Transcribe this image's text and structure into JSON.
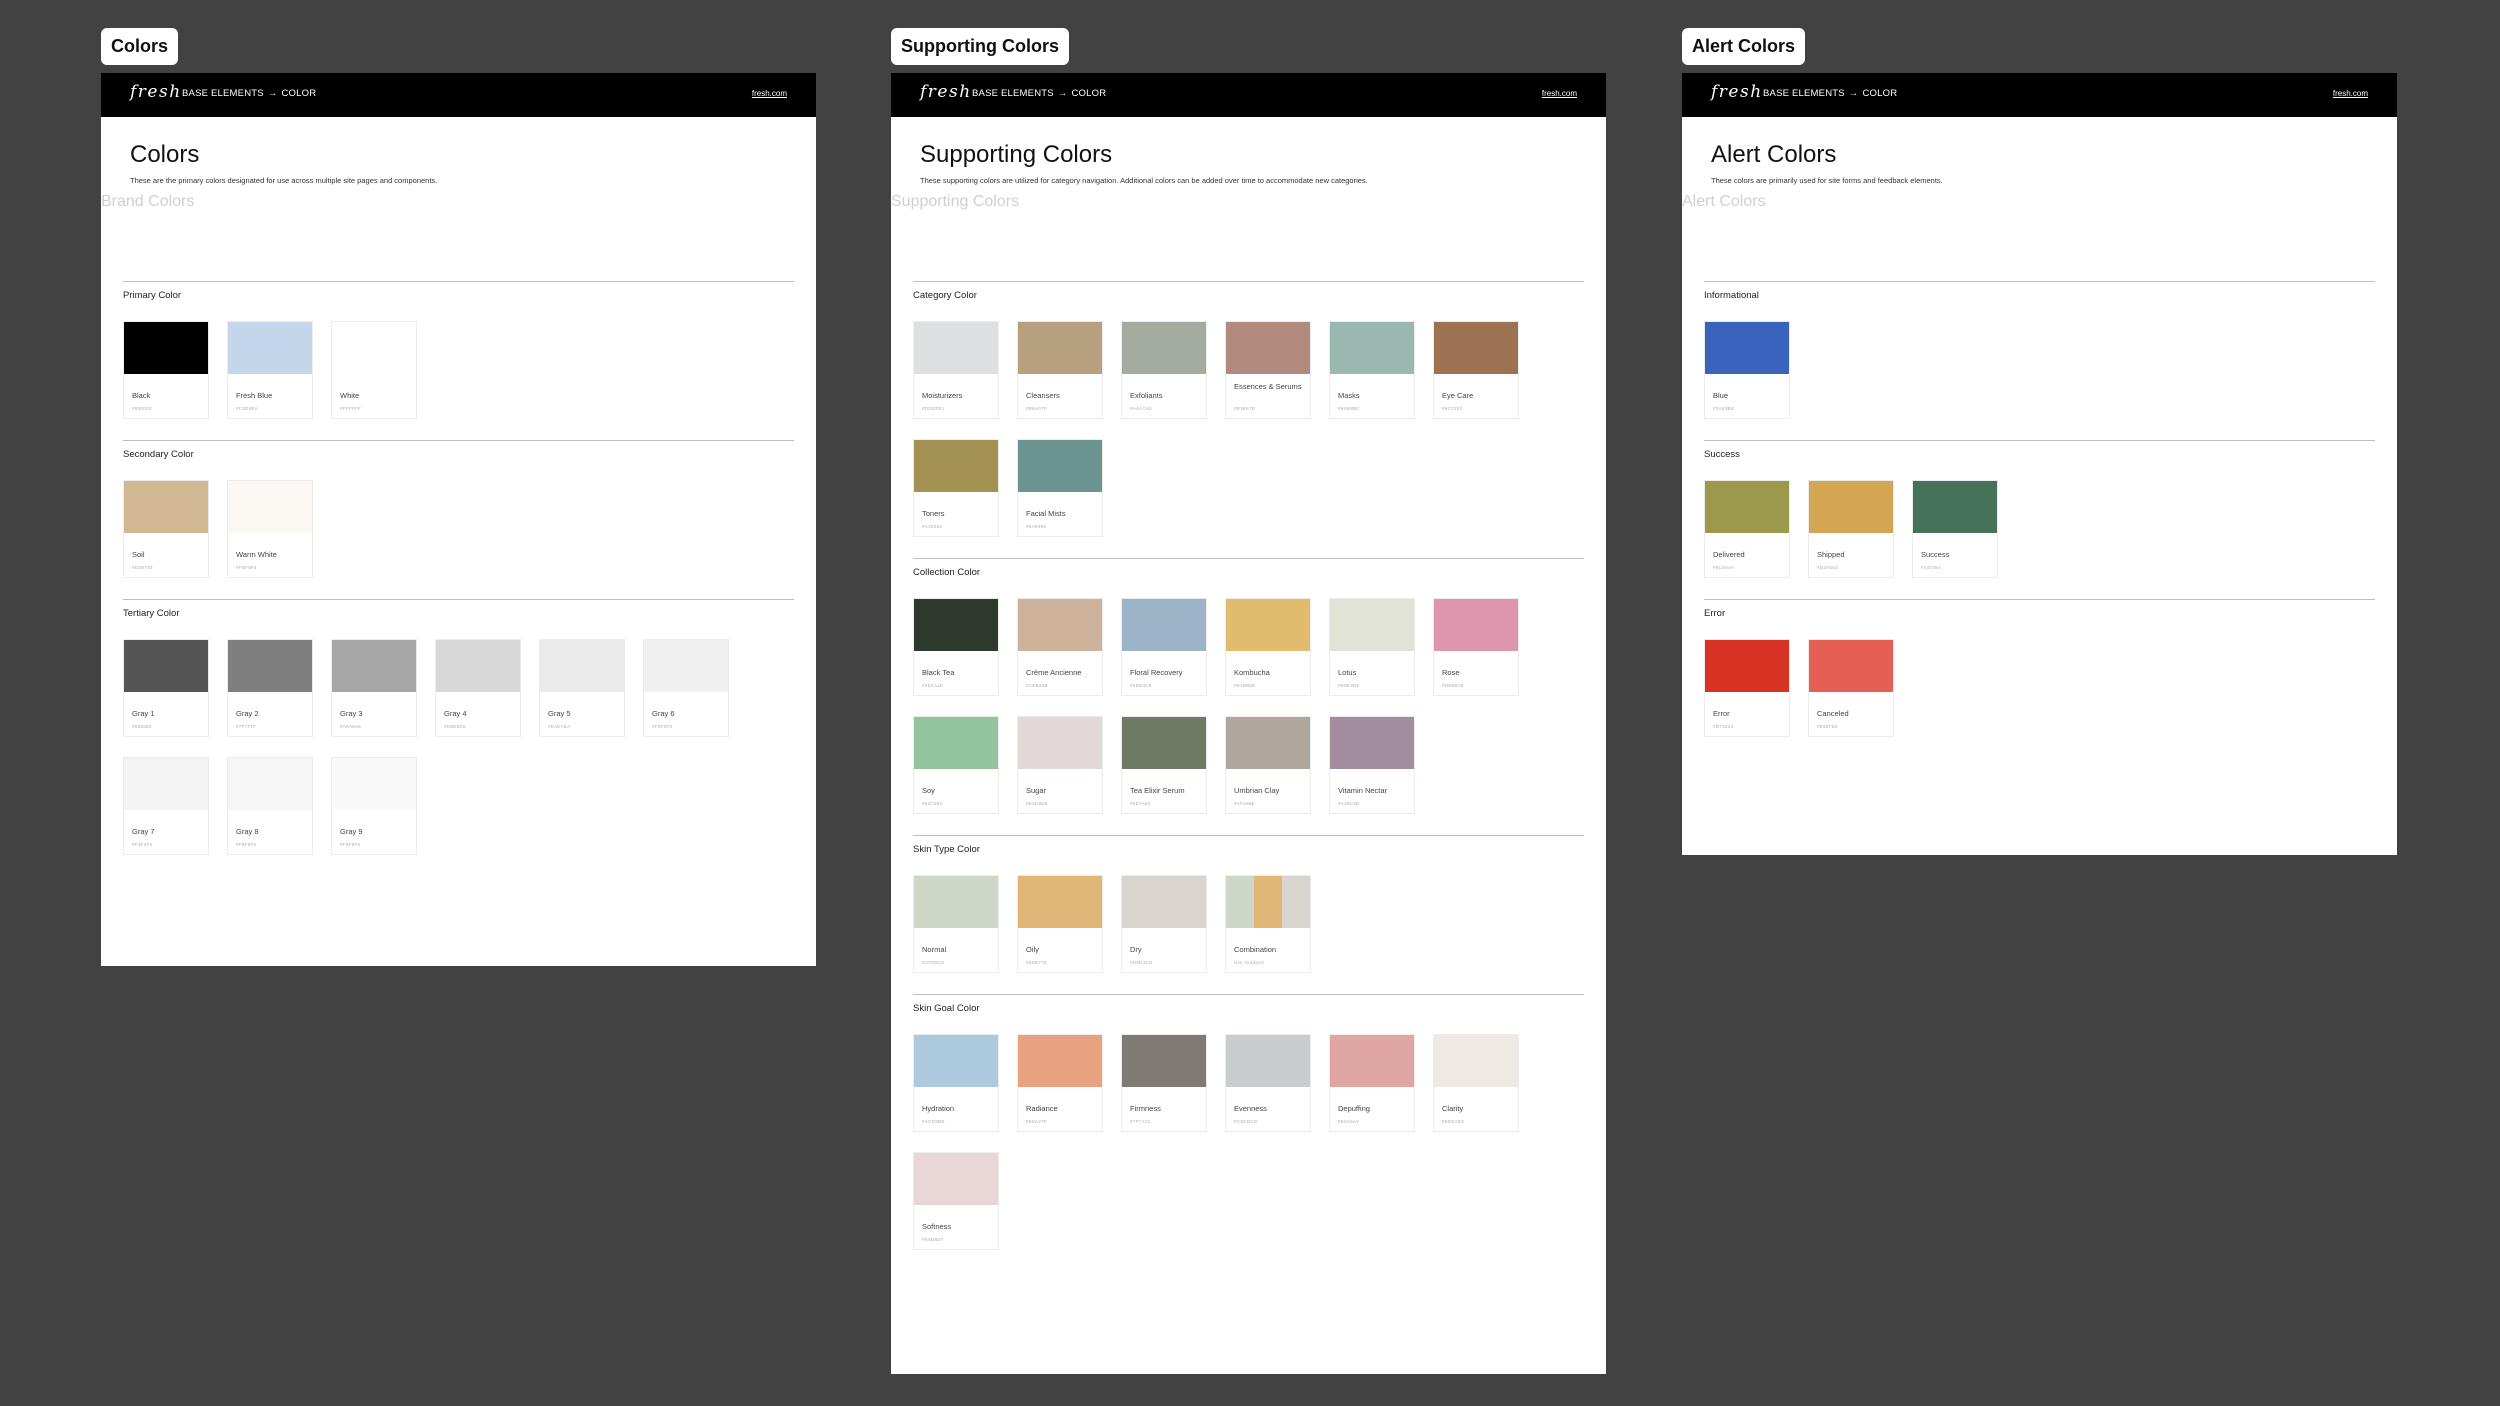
{
  "frames": [
    {
      "label": "Colors",
      "logo": "fresh",
      "crumb_base": "BASE ELEMENTS",
      "crumb_arrow": "→",
      "crumb_current": "COLOR",
      "site_link": "fresh.com",
      "title": "Colors",
      "description": "These are the primary colors designated for use across multiple site pages and components.",
      "ghost_label": "Brand Colors",
      "sections": [
        {
          "title": "Primary Color",
          "swatches": [
            {
              "name": "Black",
              "hex": "#000000",
              "colors": [
                "#000000"
              ]
            },
            {
              "name": "Fresh Blue",
              "hex": "#C3D6EA",
              "colors": [
                "#C3D6EA"
              ]
            },
            {
              "name": "White",
              "hex": "#FFFFFF",
              "colors": [
                "#FFFFFF"
              ]
            }
          ]
        },
        {
          "title": "Secondary Color",
          "swatches": [
            {
              "name": "Soil",
              "hex": "#D2B793",
              "colors": [
                "#D2B793"
              ]
            },
            {
              "name": "Warm White",
              "hex": "#FBF8F4",
              "colors": [
                "#FBF8F4"
              ]
            }
          ]
        },
        {
          "title": "Tertiary Color",
          "swatches": [
            {
              "name": "Gray 1",
              "hex": "#555555",
              "colors": [
                "#555555"
              ]
            },
            {
              "name": "Gray 2",
              "hex": "#7F7F7F",
              "colors": [
                "#7F7F7F"
              ]
            },
            {
              "name": "Gray 3",
              "hex": "#A6A6A6",
              "colors": [
                "#A6A6A6"
              ]
            },
            {
              "name": "Gray 4",
              "hex": "#D8D8D8",
              "colors": [
                "#D8D8D8"
              ]
            },
            {
              "name": "Gray 5",
              "hex": "#EAEAEA",
              "colors": [
                "#EAEAEA"
              ]
            },
            {
              "name": "Gray 6",
              "hex": "#F0F0F0",
              "colors": [
                "#F0F0F0"
              ]
            },
            {
              "name": "Gray 7",
              "hex": "#F3F3F3",
              "colors": [
                "#F3F3F3"
              ]
            },
            {
              "name": "Gray 8",
              "hex": "#F6F6F6",
              "colors": [
                "#F6F6F6"
              ]
            },
            {
              "name": "Gray 9",
              "hex": "#F9F9F9",
              "colors": [
                "#F9F9F9"
              ]
            }
          ]
        }
      ]
    },
    {
      "label": "Supporting Colors",
      "logo": "fresh",
      "crumb_base": "BASE ELEMENTS",
      "crumb_arrow": "→",
      "crumb_current": "COLOR",
      "site_link": "fresh.com",
      "title": "Supporting Colors",
      "description": "These supporting colors are utilized for category navigation. Additional colors can be added over time to accommodate new categories.",
      "ghost_label": "Supporting Colors",
      "sections": [
        {
          "title": "Category Color",
          "swatches": [
            {
              "name": "Moisturizers",
              "hex": "#DDDFE1",
              "colors": [
                "#DDDFE1"
              ]
            },
            {
              "name": "Cleansers",
              "hex": "#B6A07F",
              "colors": [
                "#B6A07F"
              ]
            },
            {
              "name": "Exfoliants",
              "hex": "#A4ACA0",
              "colors": [
                "#A4ACA0"
              ]
            },
            {
              "name": "Essences & Serums",
              "hex": "#B38A7E",
              "colors": [
                "#B38A7E"
              ]
            },
            {
              "name": "Masks",
              "hex": "#9AB8B0",
              "colors": [
                "#9AB8B0"
              ]
            },
            {
              "name": "Eye Care",
              "hex": "#9C7252",
              "colors": [
                "#9C7252"
              ]
            },
            {
              "name": "Toners",
              "hex": "#A39253",
              "colors": [
                "#A39253"
              ]
            },
            {
              "name": "Facial Mists",
              "hex": "#6A9490",
              "colors": [
                "#6A9490"
              ]
            }
          ]
        },
        {
          "title": "Collection Color",
          "swatches": [
            {
              "name": "Black Tea",
              "hex": "#2E3A2E",
              "colors": [
                "#2E3A2E"
              ]
            },
            {
              "name": "Crème Ancienne",
              "hex": "#CEB29B",
              "colors": [
                "#CEB29B"
              ]
            },
            {
              "name": "Floral Recovery",
              "hex": "#9DB3C8",
              "colors": [
                "#9DB3C8"
              ]
            },
            {
              "name": "Kombucha",
              "hex": "#E1BB6E",
              "colors": [
                "#E1BB6E"
              ]
            },
            {
              "name": "Lotus",
              "hex": "#E0E3D5",
              "colors": [
                "#E0E3D5"
              ]
            },
            {
              "name": "Rose",
              "hex": "#DD95AE",
              "colors": [
                "#DD95AE"
              ]
            },
            {
              "name": "Soy",
              "hex": "#92C59C",
              "colors": [
                "#92C59C"
              ]
            },
            {
              "name": "Sugar",
              "hex": "#E2D8D8",
              "colors": [
                "#E2D8D8"
              ]
            },
            {
              "name": "Tea Elixir Serum",
              "hex": "#6E7A64",
              "colors": [
                "#6E7A64"
              ]
            },
            {
              "name": "Umbrian Clay",
              "hex": "#AFA69E",
              "colors": [
                "#AFA69E"
              ]
            },
            {
              "name": "Vitamin Nectar",
              "hex": "#A38C9D",
              "colors": [
                "#A38C9D"
              ]
            }
          ]
        },
        {
          "title": "Skin Type Color",
          "swatches": [
            {
              "name": "Normal",
              "hex": "#CFD8C8",
              "colors": [
                "#CFD8C8"
              ]
            },
            {
              "name": "Oily",
              "hex": "#E0B776",
              "colors": [
                "#E0B776"
              ]
            },
            {
              "name": "Dry",
              "hex": "#D9D4CD",
              "colors": [
                "#D9D4CD"
              ]
            },
            {
              "name": "Combination",
              "hex": "Use Gradient",
              "colors": [
                "#CFD8C8",
                "#E0B776",
                "#D9D4CD"
              ]
            }
          ]
        },
        {
          "title": "Skin Goal Color",
          "swatches": [
            {
              "name": "Hydration",
              "hex": "#ACC9DE",
              "colors": [
                "#ACC9DE"
              ]
            },
            {
              "name": "Radiance",
              "hex": "#E8A27F",
              "colors": [
                "#E8A27F"
              ]
            },
            {
              "name": "Firmness",
              "hex": "#7F7A72",
              "colors": [
                "#7F7A72"
              ]
            },
            {
              "name": "Evenness",
              "hex": "#C9CDCD",
              "colors": [
                "#C9CDCD"
              ]
            },
            {
              "name": "Depuffing",
              "hex": "#E0A6A2",
              "colors": [
                "#E0A6A2"
              ]
            },
            {
              "name": "Clarity",
              "hex": "#EEEAE3",
              "colors": [
                "#EEEAE3"
              ]
            },
            {
              "name": "Softness",
              "hex": "#E9D6D7",
              "colors": [
                "#E9D6D7"
              ]
            }
          ]
        }
      ]
    },
    {
      "label": "Alert Colors",
      "logo": "fresh",
      "crumb_base": "BASE ELEMENTS",
      "crumb_arrow": "→",
      "crumb_current": "COLOR",
      "site_link": "fresh.com",
      "title": "Alert Colors",
      "description": "These colors are primarily used for site forms and feedback elements.",
      "ghost_label": "Alert Colors",
      "sections": [
        {
          "title": "Informational",
          "swatches": [
            {
              "name": "Blue",
              "hex": "#3A63BE",
              "colors": [
                "#3A63BE"
              ]
            }
          ]
        },
        {
          "title": "Success",
          "swatches": [
            {
              "name": "Delivered",
              "hex": "#9C9A4A",
              "colors": [
                "#9C9A4A"
              ]
            },
            {
              "name": "Shipped",
              "hex": "#D4A553",
              "colors": [
                "#D4A553"
              ]
            },
            {
              "name": "Success",
              "hex": "#44735A",
              "colors": [
                "#44735A"
              ]
            }
          ]
        },
        {
          "title": "Error",
          "swatches": [
            {
              "name": "Error",
              "hex": "#D73224",
              "colors": [
                "#D73224"
              ]
            },
            {
              "name": "Canceled",
              "hex": "#E55F55",
              "colors": [
                "#E55F55"
              ]
            }
          ]
        }
      ]
    }
  ]
}
